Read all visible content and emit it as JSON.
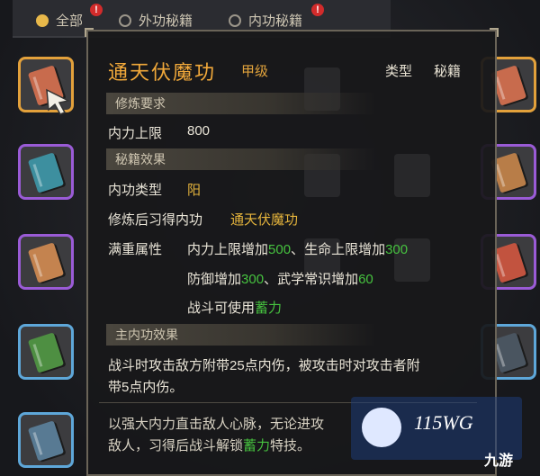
{
  "filters": [
    {
      "label": "全部",
      "selected": true,
      "badge": "!"
    },
    {
      "label": "外功秘籍",
      "selected": false,
      "badge": "!"
    },
    {
      "label": "内功秘籍",
      "selected": false,
      "badge": "!"
    }
  ],
  "tooltip": {
    "title": "通天伏魔功",
    "grade": "甲级",
    "type_label": "类型",
    "type_value": "秘籍",
    "section_req": "修炼要求",
    "req_label": "内力上限",
    "req_value": "800",
    "section_effect": "秘籍效果",
    "inner_type_label": "内功类型",
    "inner_type_value": "阳",
    "learn_label": "修炼后习得内功",
    "learn_value": "通天伏魔功",
    "full_label": "满重属性",
    "bonus1_a": "内力上限增加",
    "bonus1_a_val": "500",
    "sep": "、",
    "bonus1_b": "生命上限增加",
    "bonus1_b_val": "300",
    "bonus2_a": "防御增加",
    "bonus2_a_val": "300",
    "bonus2_b": "武学常识增加",
    "bonus2_b_val": "60",
    "battle_use": "战斗可使用",
    "battle_use_val": "蓄力",
    "section_main": "主内功效果",
    "main_line1": "战斗时攻击敌方附带25点内伤，被攻击时对攻击者附",
    "main_line2": "带5点内伤。",
    "desc_line1": "以强大内力直击敌人心脉，无论进攻",
    "desc_line2_a": "敌人，习得后战斗解锁",
    "desc_line2_b": "蓄力",
    "desc_line2_c": "特技。"
  },
  "watermark": {
    "text": "115WG",
    "text2": "九游"
  },
  "colors": {
    "accent": "#f2a93a",
    "green": "#46c23f",
    "blue_frame": "#5ea7d9",
    "gold_frame": "#e3a13b",
    "purple_frame": "#9a5bd6"
  }
}
